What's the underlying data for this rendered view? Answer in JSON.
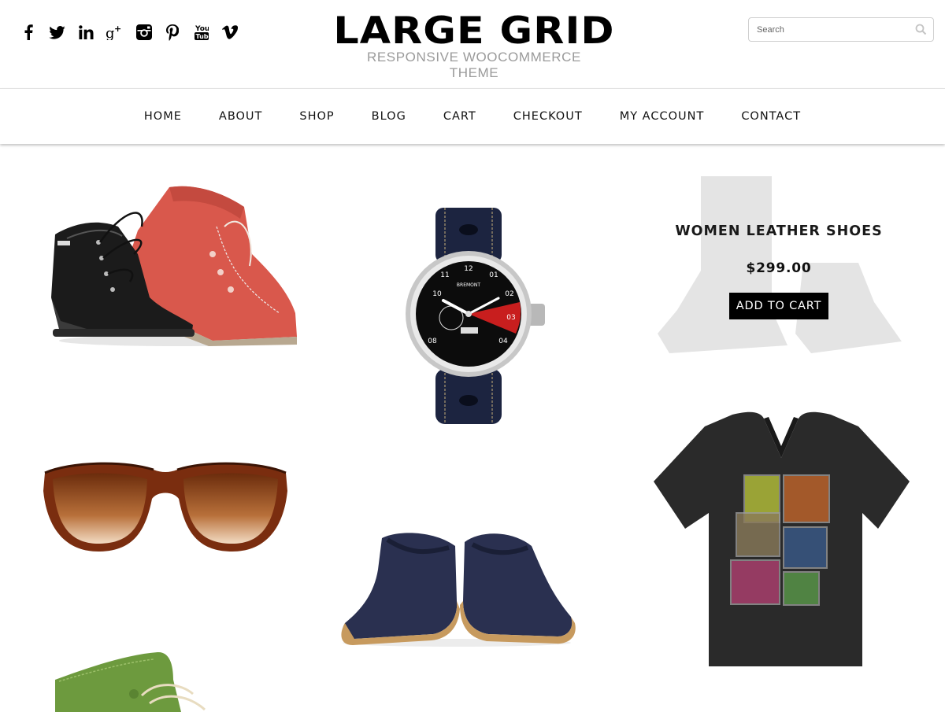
{
  "header": {
    "logo_title": "LARGE GRID",
    "logo_subtitle": "RESPONSIVE WOOCOMMERCE THEME",
    "search_placeholder": "Search",
    "social_icons": [
      "facebook-icon",
      "twitter-icon",
      "linkedin-icon",
      "google-plus-icon",
      "instagram-icon",
      "pinterest-icon",
      "youtube-icon",
      "vimeo-icon"
    ]
  },
  "nav": {
    "items": [
      "HOME",
      "ABOUT",
      "SHOP",
      "BLOG",
      "CART",
      "CHECKOUT",
      "MY ACCOUNT",
      "CONTACT"
    ]
  },
  "featured": {
    "title": "WOMEN LEATHER SHOES",
    "price": "$299.00",
    "button": "ADD TO CART"
  },
  "colors": {
    "accent": "#000000",
    "logo_subtitle": "#9a9a9a",
    "nav_text": "#111111"
  }
}
